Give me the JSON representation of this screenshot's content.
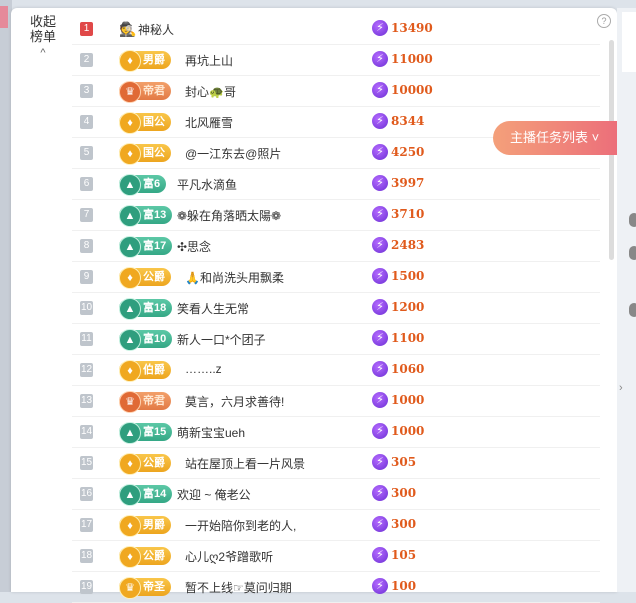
{
  "collapse": {
    "line1": "收起",
    "line2": "榜单",
    "chev": "^"
  },
  "help": "?",
  "task_button": "主播任务列表",
  "rows": [
    {
      "rank": "1",
      "badge_type": "mystery",
      "badge": "",
      "badge_icon": "",
      "name": "神秘人",
      "score": "13490"
    },
    {
      "rank": "2",
      "badge_type": "noble",
      "badge": "男爵",
      "badge_icon": "♦",
      "name": "再坑上山",
      "score": "11000"
    },
    {
      "rank": "3",
      "badge_type": "emperor",
      "badge": "帝君",
      "badge_icon": "♛",
      "name": "封心🐢哥",
      "score": "10000"
    },
    {
      "rank": "4",
      "badge_type": "noble",
      "badge": "国公",
      "badge_icon": "♦",
      "name": "北风雁雪",
      "score": "8344"
    },
    {
      "rank": "5",
      "badge_type": "noble",
      "badge": "国公",
      "badge_icon": "♦",
      "name": "@一江东去@照片",
      "score": "4250"
    },
    {
      "rank": "6",
      "badge_type": "wealth",
      "badge": "富6",
      "badge_icon": "▲",
      "name": "平凡水滴鱼",
      "score": "3997"
    },
    {
      "rank": "7",
      "badge_type": "wealth",
      "badge": "富13",
      "badge_icon": "▲",
      "name": "❁躲在角落晒太陽❁",
      "score": "3710"
    },
    {
      "rank": "8",
      "badge_type": "wealth",
      "badge": "富17",
      "badge_icon": "▲",
      "name": "✣思念",
      "score": "2483"
    },
    {
      "rank": "9",
      "badge_type": "noble",
      "badge": "公爵",
      "badge_icon": "♦",
      "name": "🙏和尚洗头用飘柔",
      "score": "1500"
    },
    {
      "rank": "10",
      "badge_type": "wealth",
      "badge": "富18",
      "badge_icon": "▲",
      "name": "笑看人生无常",
      "score": "1200"
    },
    {
      "rank": "11",
      "badge_type": "wealth",
      "badge": "富10",
      "badge_icon": "▲",
      "name": "新人一口*个团子",
      "score": "1100"
    },
    {
      "rank": "12",
      "badge_type": "noble",
      "badge": "伯爵",
      "badge_icon": "♦",
      "name": "……..z",
      "score": "1060"
    },
    {
      "rank": "13",
      "badge_type": "emperor",
      "badge": "帝君",
      "badge_icon": "♛",
      "name": "莫言，六月求善待!",
      "score": "1000"
    },
    {
      "rank": "14",
      "badge_type": "wealth",
      "badge": "富15",
      "badge_icon": "▲",
      "name": "萌新宝宝ueh",
      "score": "1000"
    },
    {
      "rank": "15",
      "badge_type": "noble",
      "badge": "公爵",
      "badge_icon": "♦",
      "name": "站在屋顶上看一片风景",
      "score": "305"
    },
    {
      "rank": "16",
      "badge_type": "wealth",
      "badge": "富14",
      "badge_icon": "▲",
      "name": "欢迎 ~ 俺老公",
      "score": "300"
    },
    {
      "rank": "17",
      "badge_type": "noble",
      "badge": "男爵",
      "badge_icon": "♦",
      "name": "一开始陪你到老的人,",
      "score": "300"
    },
    {
      "rank": "18",
      "badge_type": "noble",
      "badge": "公爵",
      "badge_icon": "♦",
      "name": "心儿ღ2爷蹭歌听",
      "score": "105"
    },
    {
      "rank": "19",
      "badge_type": "noble",
      "badge": "帝圣",
      "badge_icon": "♛",
      "name": "暂不上线☞莫问归期",
      "score": "100"
    }
  ],
  "bolt_icon": "⚡",
  "colors": {
    "rank_top": "#e04848",
    "score": "#e05a1c",
    "accent": "#ec6f7a"
  }
}
